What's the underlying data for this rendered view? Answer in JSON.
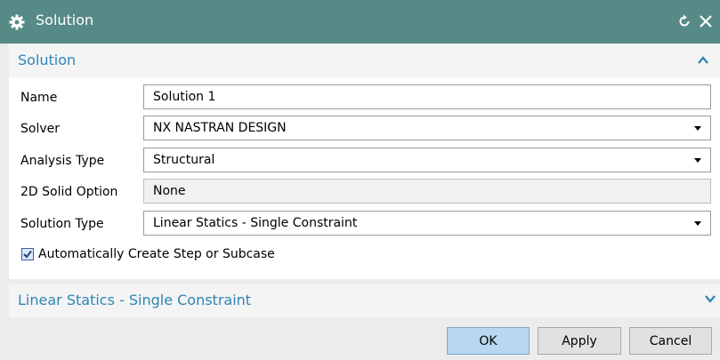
{
  "window": {
    "title": "Solution",
    "icons": {
      "app": "gear-icon",
      "reset": "reset-icon",
      "close": "close-icon"
    }
  },
  "section_solution": {
    "title": "Solution",
    "expanded": true
  },
  "form": {
    "name": {
      "label": "Name",
      "value": "Solution 1"
    },
    "solver": {
      "label": "Solver",
      "value": "NX NASTRAN DESIGN"
    },
    "analysis_type": {
      "label": "Analysis Type",
      "value": "Structural"
    },
    "solid_option_2d": {
      "label": "2D Solid Option",
      "value": "None"
    },
    "solution_type": {
      "label": "Solution Type",
      "value": "Linear Statics - Single Constraint"
    },
    "auto_create": {
      "label": "Automatically Create Step or Subcase",
      "checked": true
    }
  },
  "section_linear": {
    "title": "Linear Statics - Single Constraint",
    "expanded": false
  },
  "buttons": {
    "ok": "OK",
    "apply": "Apply",
    "cancel": "Cancel"
  },
  "colors": {
    "titlebar": "#568a86",
    "section_title": "#2f86b3",
    "ok_button": "#b7d8ee"
  }
}
